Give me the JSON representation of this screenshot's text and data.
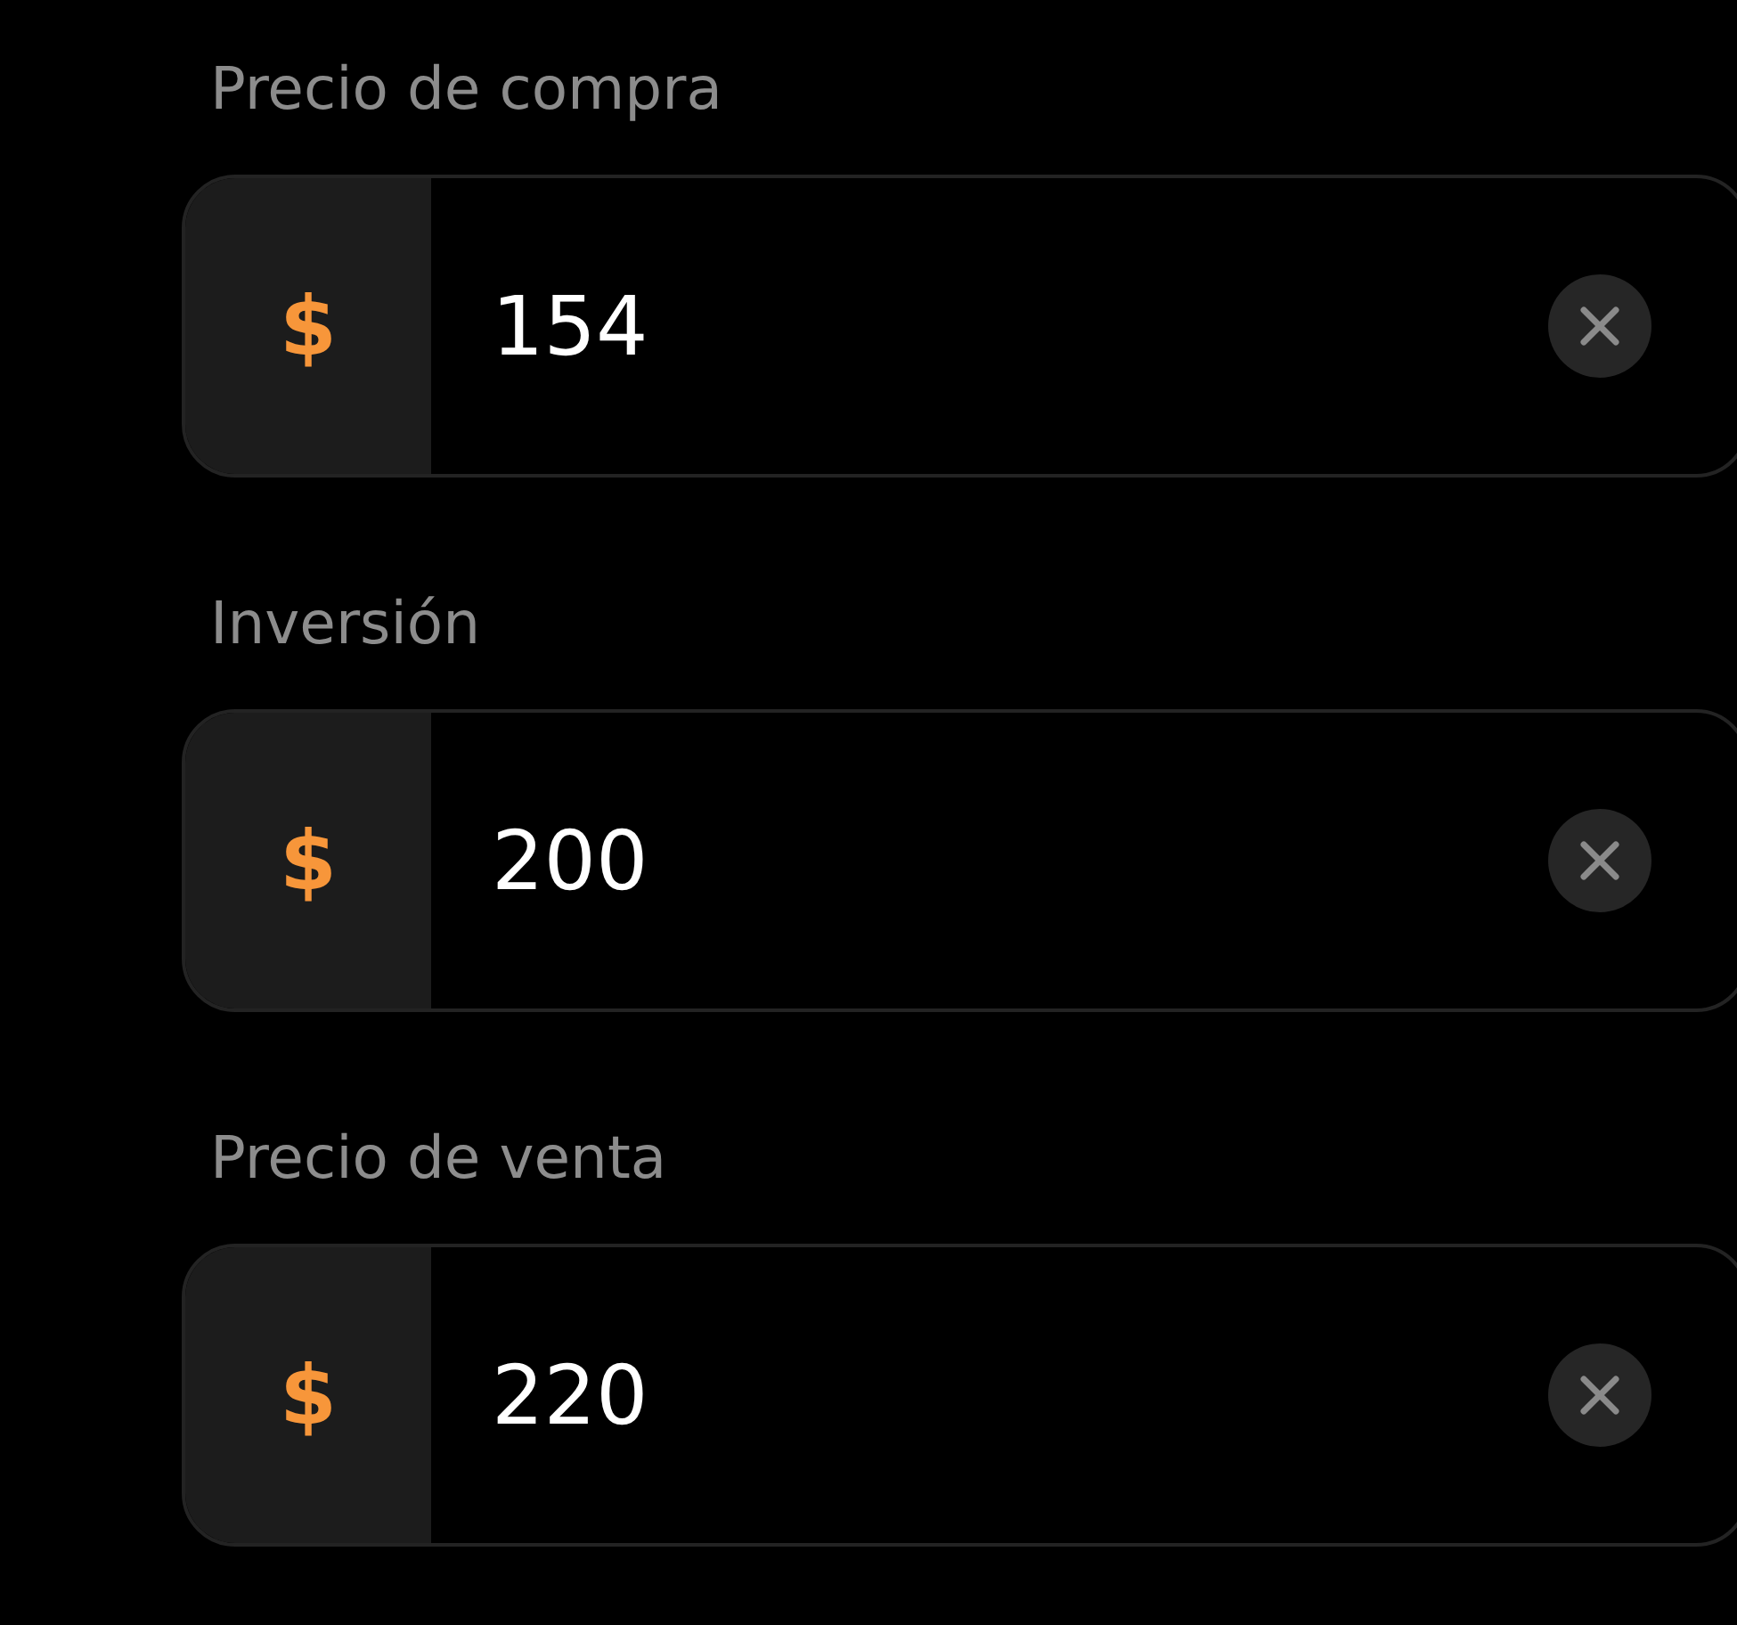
{
  "fields": [
    {
      "label": "Precio de compra",
      "prefix": "$",
      "value": "154"
    },
    {
      "label": "Inversión",
      "prefix": "$",
      "value": "200"
    },
    {
      "label": "Precio de venta",
      "prefix": "$",
      "value": "220"
    }
  ]
}
